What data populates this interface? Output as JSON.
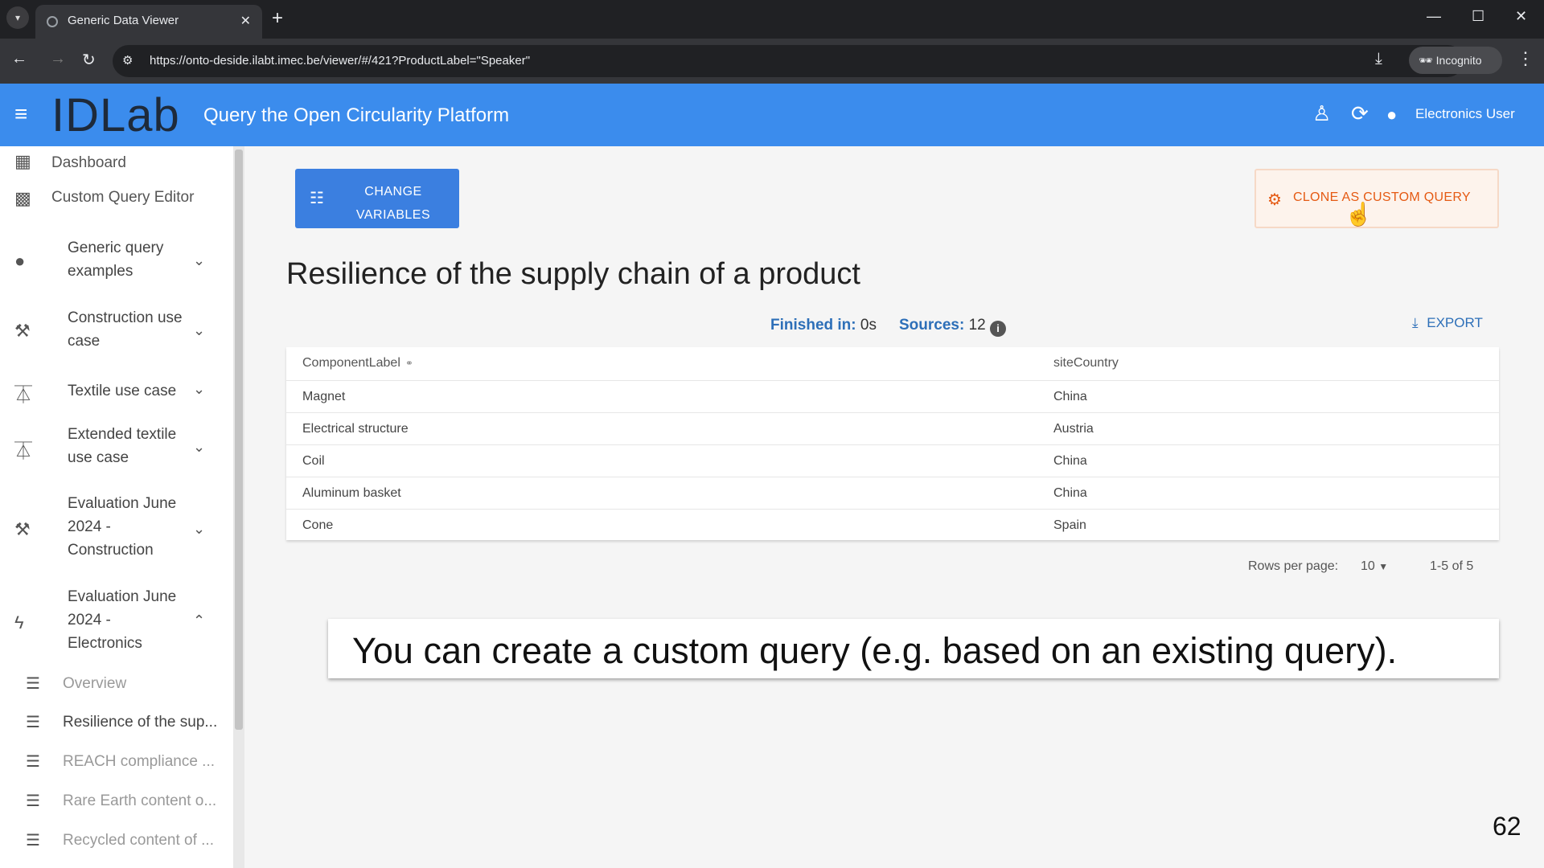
{
  "browser": {
    "tab_title": "Generic Data Viewer",
    "url": "https://onto-deside.ilabt.imec.be/viewer/#/421?ProductLabel=\"Speaker\"",
    "incognito_label": "Incognito"
  },
  "appbar": {
    "logo": "IDLab",
    "title": "Query the Open Circularity Platform",
    "user_label": "Electronics User"
  },
  "sidebar": {
    "dashboard": "Dashboard",
    "custom_query_editor": "Custom Query Editor",
    "groups": [
      {
        "label": "Generic query examples"
      },
      {
        "label": "Construction use case"
      },
      {
        "label": "Textile use case"
      },
      {
        "label": "Extended textile use case"
      },
      {
        "label": "Evaluation June 2024 - Construction"
      },
      {
        "label": "Evaluation June 2024 - Electronics"
      }
    ],
    "sub_items": [
      {
        "label": "Overview"
      },
      {
        "label": "Resilience of the sup..."
      },
      {
        "label": "REACH compliance ..."
      },
      {
        "label": "Rare Earth content o..."
      },
      {
        "label": "Recycled content of ..."
      }
    ]
  },
  "main": {
    "change_variables": "CHANGE VARIABLES",
    "clone_button": "CLONE AS CUSTOM QUERY",
    "title": "Resilience of the supply chain of a product",
    "finished_label": "Finished in:",
    "finished_value": "0s",
    "sources_label": "Sources:",
    "sources_value": "12",
    "export": "EXPORT",
    "table": {
      "columns": [
        "ComponentLabel",
        "siteCountry"
      ],
      "rows": [
        [
          "Magnet",
          "China"
        ],
        [
          "Electrical structure",
          "Austria"
        ],
        [
          "Coil",
          "China"
        ],
        [
          "Aluminum basket",
          "China"
        ],
        [
          "Cone",
          "Spain"
        ]
      ]
    },
    "rows_per_page_label": "Rows per page:",
    "rows_per_page_value": "10",
    "range": "1-5 of 5"
  },
  "caption": "You can create a custom query (e.g. based on an existing query).",
  "page_number": "62",
  "colors": {
    "appbar": "#3b8ced",
    "primary_button": "#3b7fe0",
    "clone_accent": "#e55a13",
    "link_blue": "#2d6fb8"
  }
}
